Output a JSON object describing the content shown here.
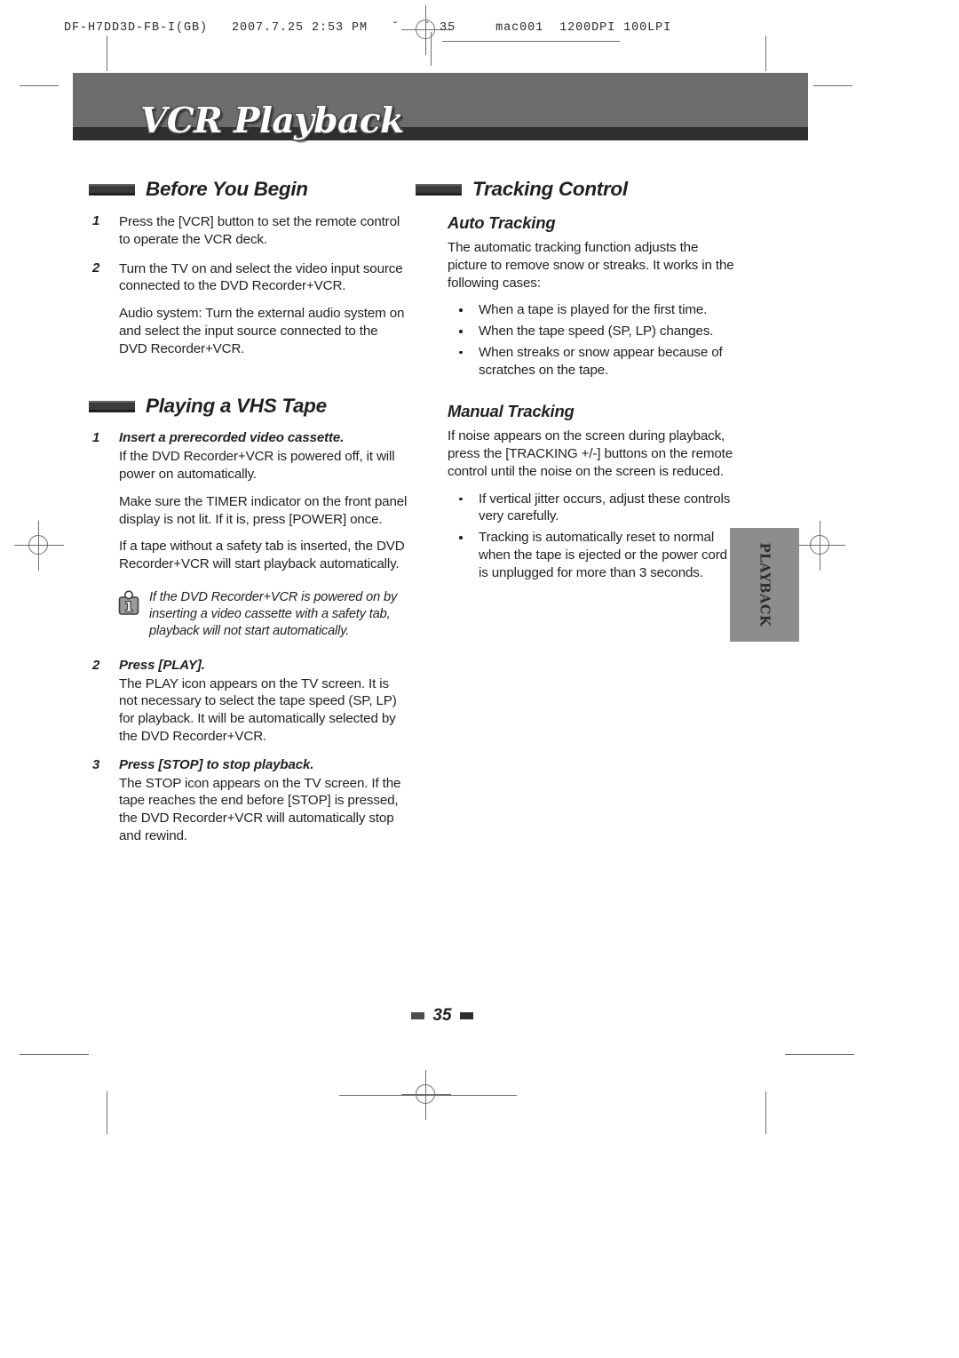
{
  "print_slug": "DF-H7DD3D-FB-I(GB)   2007.7.25 2:53 PM   ˘   ` 35     mac001  1200DPI 100LPI",
  "chapter": {
    "title": "VCR Playback",
    "side_tab_label": "PLAYBACK"
  },
  "colors": {
    "banner_gray": "#6d6d6d",
    "banner_bar_dark": "#303030",
    "tab_gray": "#8c8c8c",
    "text": "#231f20"
  },
  "left_column": {
    "section1": {
      "heading": "Before You Begin",
      "steps": [
        {
          "num": "1",
          "paragraphs": [
            "Press the [VCR] button to set the remote control to operate the VCR deck."
          ]
        },
        {
          "num": "2",
          "paragraphs": [
            "Turn the TV on and select the video input source connected to the DVD Recorder+VCR.",
            "Audio system: Turn the external audio system on and select the input source connected to the DVD Recorder+VCR."
          ]
        }
      ]
    },
    "section2": {
      "heading": "Playing a VHS Tape",
      "steps": [
        {
          "num": "1",
          "title": "Insert a prerecorded video cassette.",
          "paragraphs": [
            "If the DVD Recorder+VCR is powered off, it will power on automatically.",
            "Make sure the TIMER indicator on the front panel display is not lit. If it is, press [POWER] once.",
            "If a tape without a safety tab is inserted, the DVD Recorder+VCR will start playback automatically."
          ]
        },
        {
          "num": "2",
          "title": "Press [PLAY].",
          "paragraphs": [
            "The PLAY icon appears on the TV screen. It is not necessary to select the tape speed (SP, LP) for playback. It will be automatically selected by the DVD Recorder+VCR."
          ]
        },
        {
          "num": "3",
          "title": "Press [STOP] to stop playback.",
          "paragraphs": [
            "The STOP icon appears on the TV screen. If the tape reaches the end before [STOP] is pressed, the DVD Recorder+VCR will automatically stop and rewind."
          ]
        }
      ],
      "note": {
        "icon": "info-icon",
        "text": "If the DVD Recorder+VCR is powered on by inserting a video cassette with a safety tab, playback will not start automatically."
      }
    }
  },
  "right_column": {
    "heading": "Tracking Control",
    "auto_tracking": {
      "subheading": "Auto Tracking",
      "intro": "The automatic tracking function adjusts the picture to remove snow or streaks. It works in the following cases:",
      "bullets": [
        "When a tape is played for the first time.",
        "When the tape speed (SP, LP) changes.",
        "When streaks or snow appear because of scratches on the tape."
      ]
    },
    "manual_tracking": {
      "subheading": "Manual Tracking",
      "intro": "If noise appears on the screen during playback, press the [TRACKING +/-] buttons on the remote control until the noise on the screen is reduced.",
      "bullets": [
        "If vertical jitter occurs, adjust these controls very carefully.",
        "Tracking is automatically reset to normal when the tape is ejected or the power cord is unplugged for more than 3 seconds."
      ]
    }
  },
  "footer": {
    "page_number": "35"
  }
}
